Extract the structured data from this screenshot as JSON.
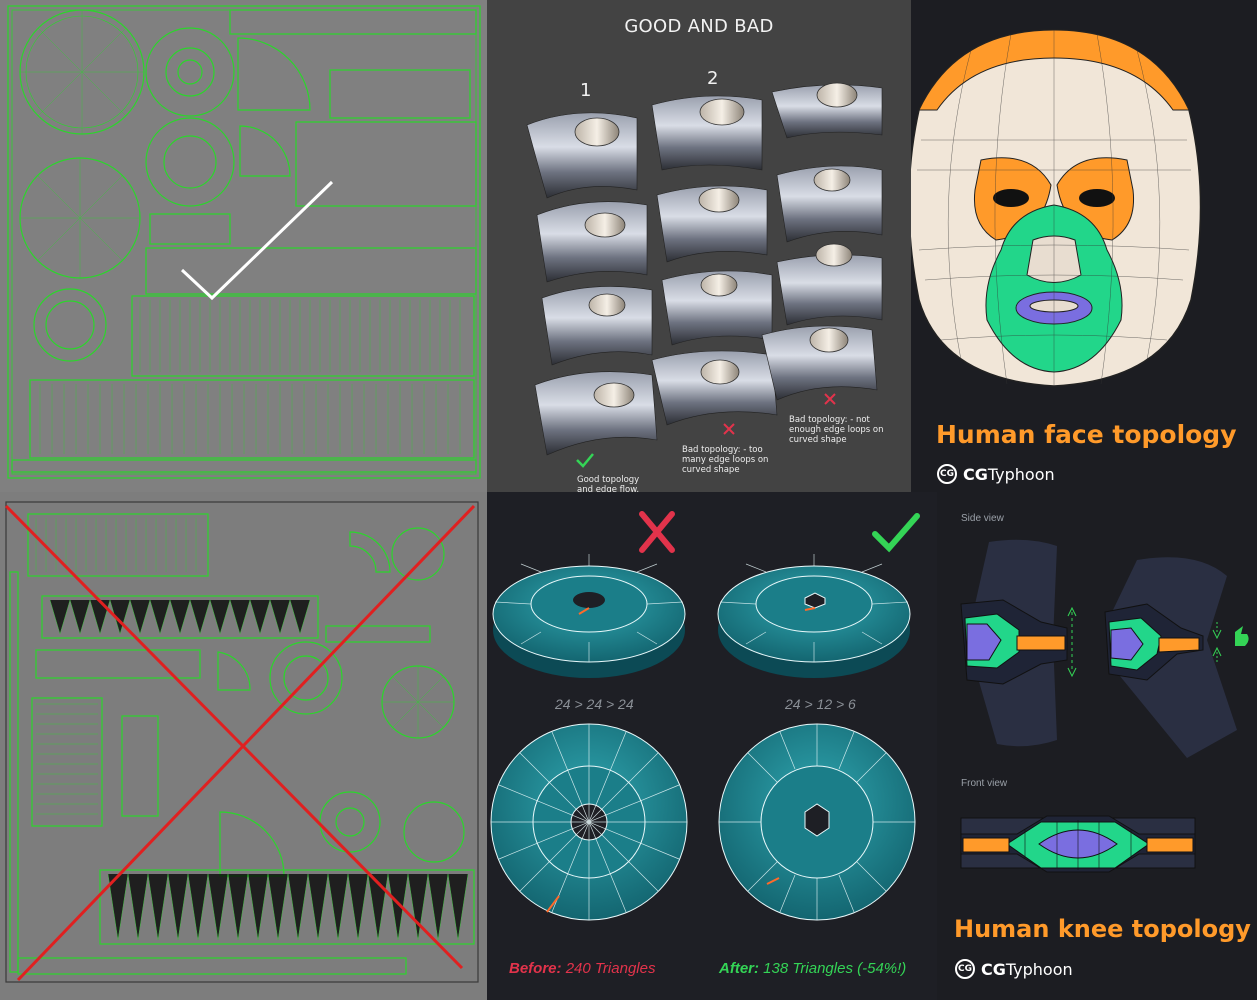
{
  "good_bad_panel": {
    "title": "GOOD AND BAD",
    "column_1": "1",
    "column_2": "2",
    "note_good": "Good topology and edge flow.",
    "note_bad_1": "Bad topology: - too many edge loops on curved shape",
    "note_bad_2": "Bad topology: - not enough edge loops on curved shape"
  },
  "face_panel": {
    "title": "Human face topology",
    "brand_logo": "CG",
    "brand_name_bold": "CG",
    "brand_name_rest": "Typhoon"
  },
  "ring_panel": {
    "ratio_left": "24 > 24 > 24",
    "ratio_right": "24 > 12 > 6",
    "before_label": "Before:",
    "before_value": "240 Triangles",
    "after_label": "After:",
    "after_value": "138 Triangles (-54%!)"
  },
  "knee_panel": {
    "side_view_label": "Side view",
    "front_view_label": "Front view",
    "title": "Human knee topology",
    "brand_logo": "CG",
    "brand_name_bold": "CG",
    "brand_name_rest": "Typhoon"
  },
  "colors": {
    "uv_green": "#2bd62b",
    "uv_bg": "#7d7d7d",
    "dark_bg": "#1c1d22",
    "accent_orange": "#ff9a2a",
    "bad_red": "#e2334b",
    "good_green": "#34d456",
    "teal": "#1f8a95",
    "face_green": "#22d68a",
    "face_purple": "#7a6ee0"
  }
}
